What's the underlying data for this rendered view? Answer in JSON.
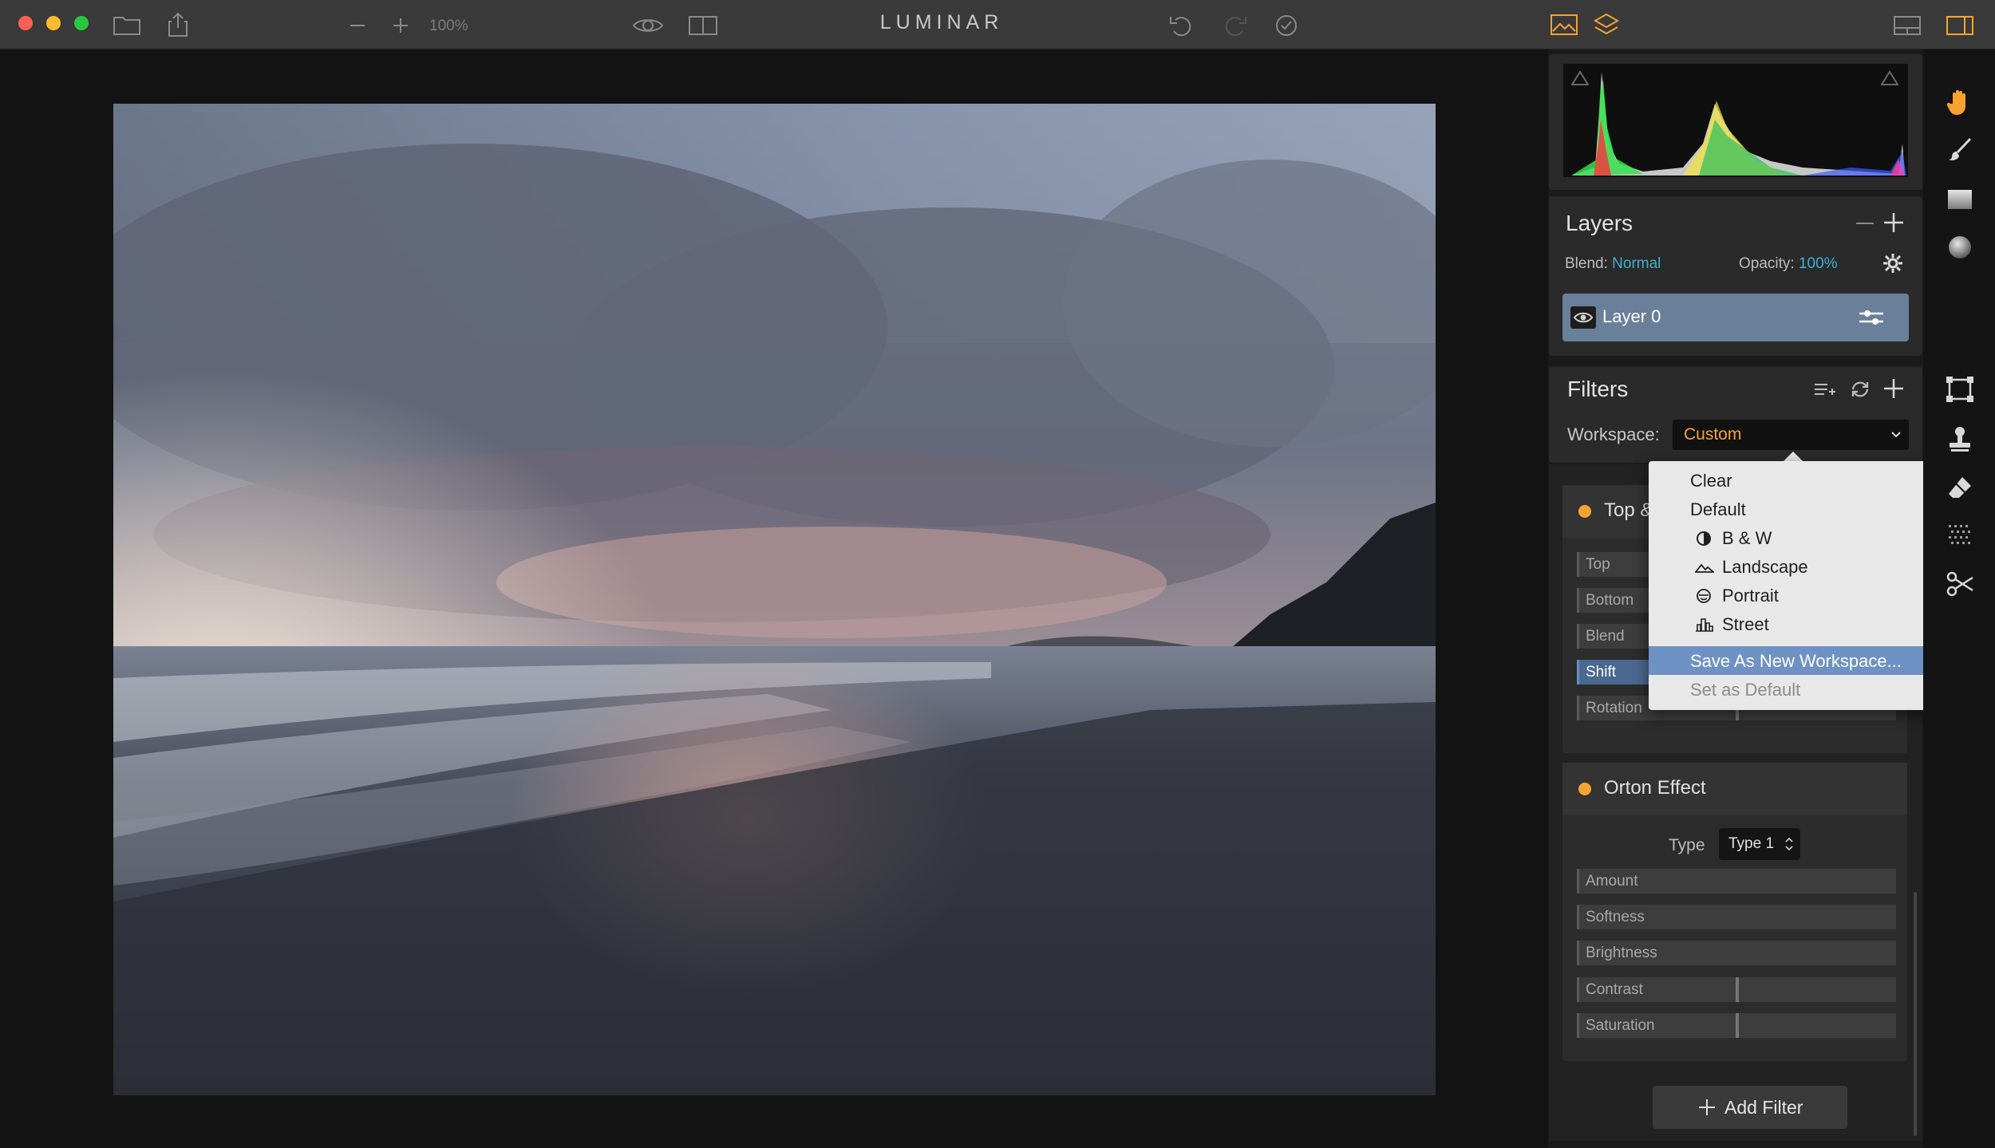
{
  "app": {
    "title": "LUMINAR",
    "zoom": "100%"
  },
  "colors": {
    "accent": "#3fb1d1",
    "workspace_value": "#f6a332",
    "layer_selected": "#6a7f99",
    "menu_highlight": "#6f92c4"
  },
  "layers": {
    "title": "Layers",
    "blend_label": "Blend:",
    "blend_value": "Normal",
    "opacity_label": "Opacity:",
    "opacity_value": "100%",
    "items": [
      {
        "name": "Layer 0"
      }
    ]
  },
  "filters": {
    "title": "Filters",
    "workspace_label": "Workspace:",
    "workspace_value": "Custom",
    "cards": [
      {
        "title": "Top & Bottom Lighting",
        "visible_title": "Top &",
        "sliders": [
          "Top",
          "Bottom",
          "Blend",
          "Shift",
          "Rotation"
        ]
      },
      {
        "title": "Orton Effect",
        "type_label": "Type",
        "type_value": "Type 1",
        "sliders": [
          "Amount",
          "Softness",
          "Brightness",
          "Contrast",
          "Saturation"
        ]
      }
    ],
    "add_filter_label": "Add Filter"
  },
  "workspace_menu": {
    "items": [
      {
        "label": "Clear",
        "icon": ""
      },
      {
        "label": "Default",
        "icon": ""
      },
      {
        "label": "B & W",
        "icon": "bw-circle-icon"
      },
      {
        "label": "Landscape",
        "icon": "mountain-icon"
      },
      {
        "label": "Portrait",
        "icon": "face-icon"
      },
      {
        "label": "Street",
        "icon": "buildings-icon"
      },
      {
        "label": "Save As New Workspace...",
        "icon": ""
      },
      {
        "label": "Set as Default",
        "icon": ""
      }
    ]
  },
  "toolbar_right": {
    "tools": [
      "hand-icon",
      "brush-icon",
      "gradient-icon",
      "radial-icon",
      "crop-icon",
      "clone-stamp-icon",
      "eraser-icon",
      "noise-icon",
      "scissors-icon"
    ]
  }
}
